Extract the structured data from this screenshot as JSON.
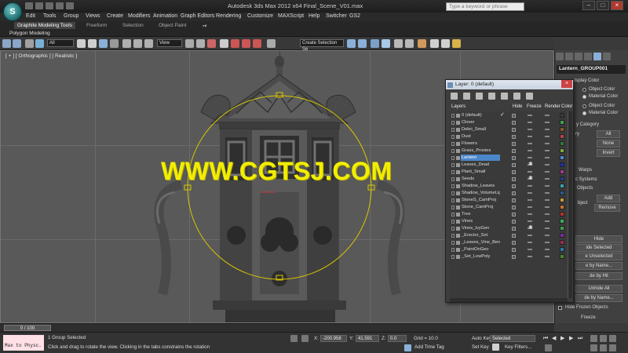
{
  "app": {
    "title": "Autodesk 3ds Max 2012 x64      Final_Scene_V01.max",
    "search_placeholder": "Type a keyword or phrase",
    "logo": "3ds-max-logo"
  },
  "menubar": [
    "Edit",
    "Tools",
    "Group",
    "Views",
    "Create",
    "Modifiers",
    "Animation",
    "Graph Editors",
    "Rendering",
    "Customize",
    "MAXScript",
    "Help",
    "Switcher",
    "GS2"
  ],
  "ribbon": {
    "tabs": [
      "Graphite Modeling Tools",
      "Freeform",
      "Selection",
      "Object Paint"
    ],
    "sub_label": "Polygon Modeling"
  },
  "toolbar": {
    "selection_filter": "All",
    "reference_coord": "View",
    "named_selection": "Create Selection Se"
  },
  "viewport": {
    "label": "[ + ] [ Orthographic ] [ Realistic ]",
    "watermark": "WWW.CGTSJ.COM"
  },
  "command_panel": {
    "object_name": "Lantern_GROUP001",
    "display_color_label": "isplay Color",
    "radio_object_color_1": "Object Color",
    "radio_material_color_1": "Material Color",
    "radio_object_color_2": "Object Color",
    "radio_material_color_2": "Material Color",
    "by_category": "y Category",
    "btn_all": "All",
    "btn_none": "None",
    "btn_invert": "Invert",
    "items": [
      "ry",
      "Warps",
      "c Systems",
      "Objects"
    ],
    "btn_add": "Add",
    "btn_remove": "Remove",
    "object_label": "bject",
    "btn_hide": "Hide",
    "btn_hide_selected": "ide Selected",
    "btn_hide_unselected": "e Unselected",
    "btn_hide_by_name": "e by Name...",
    "btn_hide_by_hit": "de by Hit",
    "btn_unhide_all": "Unhide All",
    "btn_unhide_by_name": "de by Name...",
    "hide_frozen": "Hide Frozen Objects",
    "freeze_label": "Freeze"
  },
  "layer_dialog": {
    "title": "Layer: 0 (default)",
    "close": "×",
    "columns": [
      "Layers",
      "Hide",
      "Freeze",
      "Render",
      "Color"
    ],
    "layers": [
      {
        "name": "0 (default)",
        "color": "#3a3a3a",
        "check": "✓"
      },
      {
        "name": "Clover",
        "color": "#3da24c"
      },
      {
        "name": "Debri_Small",
        "color": "#8a5a2b"
      },
      {
        "name": "Dust",
        "color": "#b74646"
      },
      {
        "name": "Flowers",
        "color": "#2d7a3a"
      },
      {
        "name": "Grass_Proxies",
        "color": "#7ca83b"
      },
      {
        "name": "Lantern",
        "color": "#4b8ad4",
        "selected": true
      },
      {
        "name": "Leaves_Dead",
        "color": "#1d2fa5",
        "freeze": true
      },
      {
        "name": "Plant_Small",
        "color": "#a33a8b"
      },
      {
        "name": "Seeds",
        "color": "#244080",
        "freeze": true
      },
      {
        "name": "Shadow_Leaves",
        "color": "#3aa3b0"
      },
      {
        "name": "Shadow_VolumeLigh",
        "color": "#2b5a8f"
      },
      {
        "name": "StoneS_CamProj",
        "color": "#c79a3a"
      },
      {
        "name": "Stone_CamProj",
        "color": "#cc6f2e"
      },
      {
        "name": "Tree",
        "color": "#b43030"
      },
      {
        "name": "Vines",
        "color": "#3ab05a"
      },
      {
        "name": "Vines_IvyGen",
        "color": "#3da24c",
        "freeze": true
      },
      {
        "name": "_Erector_Set",
        "color": "#7a2aa5"
      },
      {
        "name": "_Leaves_Vine_Bent",
        "color": "#a52a4a"
      },
      {
        "name": "_PaintOnGeo",
        "color": "#2a7aa5"
      },
      {
        "name": "_Set_LowPoly",
        "color": "#4a8a2a"
      }
    ]
  },
  "timeslider": {
    "frame": "0 / 100"
  },
  "statusbar": {
    "maxscript": "Max to Physc.",
    "selection": "1 Group Selected",
    "prompt": "Click and drag to rotate the view.  Clicking in the tabs constrains the rotation",
    "x_label": "X:",
    "x_value": "-200.958",
    "y_label": "Y:",
    "y_value": "41.591",
    "z_label": "Z:",
    "z_value": "0.0",
    "grid": "Grid = 10.0",
    "add_time_tag": "Add Time Tag",
    "auto_key": "Auto Key",
    "selected_dropdown": "Selected",
    "set_key": "Set Key",
    "key_filters": "Key Filters..."
  }
}
